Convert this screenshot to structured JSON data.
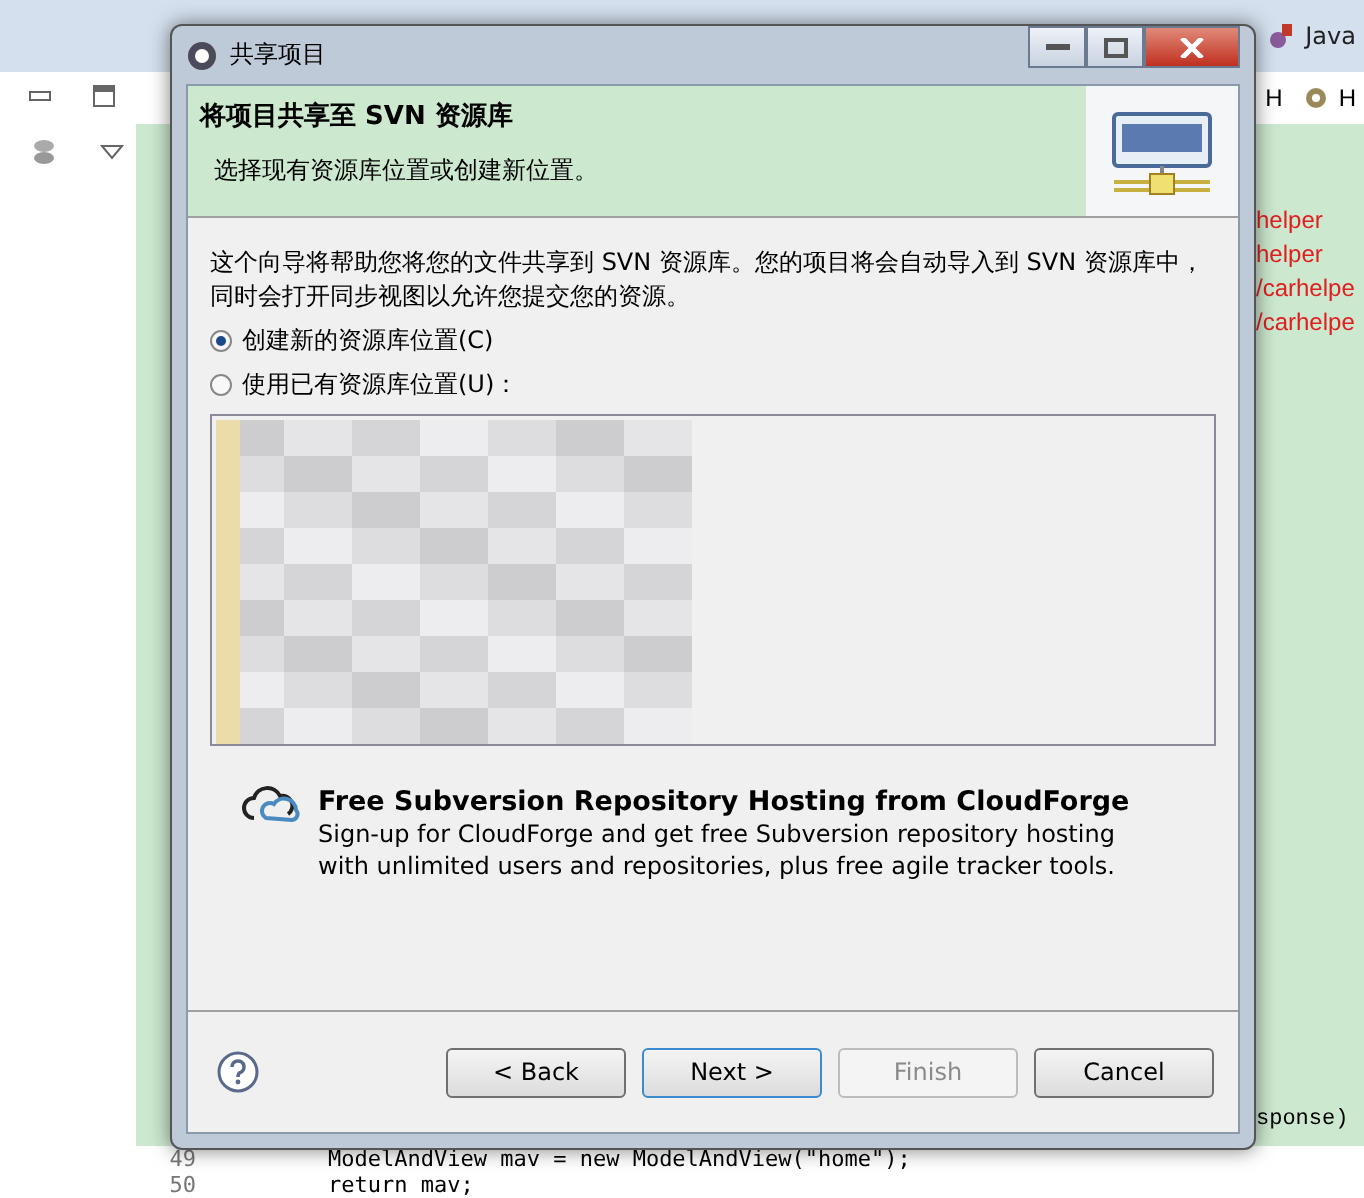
{
  "ide": {
    "perspectives": [
      {
        "label": "Java"
      }
    ],
    "editor_tabs": [
      {
        "label": "H"
      },
      {
        "label": "H"
      }
    ],
    "console_lines": [
      "helper",
      "helper",
      "/carhelpe",
      "/carhelpe"
    ],
    "console_tail": "sponse)",
    "code_lines": [
      {
        "number": "49",
        "text": "ModelAndView mav = new ModelAndView(\"home\");"
      },
      {
        "number": "50",
        "text": "return mav;"
      }
    ]
  },
  "dialog": {
    "title": "共享项目",
    "header_title": "将项目共享至 SVN 资源库",
    "header_subtitle": "选择现有资源库位置或创建新位置。",
    "description": "这个向导将帮助您将您的文件共享到 SVN 资源库。您的项目将会自动导入到 SVN 资源库中，同时会打开同步视图以允许您提交您的资源。",
    "options": [
      {
        "label": "创建新的资源库位置(C)",
        "selected": true
      },
      {
        "label": "使用已有资源库位置(U)：",
        "selected": false
      }
    ],
    "promo": {
      "title": "Free Subversion Repository Hosting from CloudForge",
      "text": "Sign-up for CloudForge and get free Subversion repository hosting with unlimited users and repositories, plus free agile tracker tools."
    },
    "buttons": [
      {
        "label": "< Back",
        "disabled": false,
        "default": false
      },
      {
        "label": "Next >",
        "disabled": false,
        "default": true
      },
      {
        "label": "Finish",
        "disabled": true,
        "default": false
      },
      {
        "label": "Cancel",
        "disabled": false,
        "default": false
      }
    ]
  }
}
